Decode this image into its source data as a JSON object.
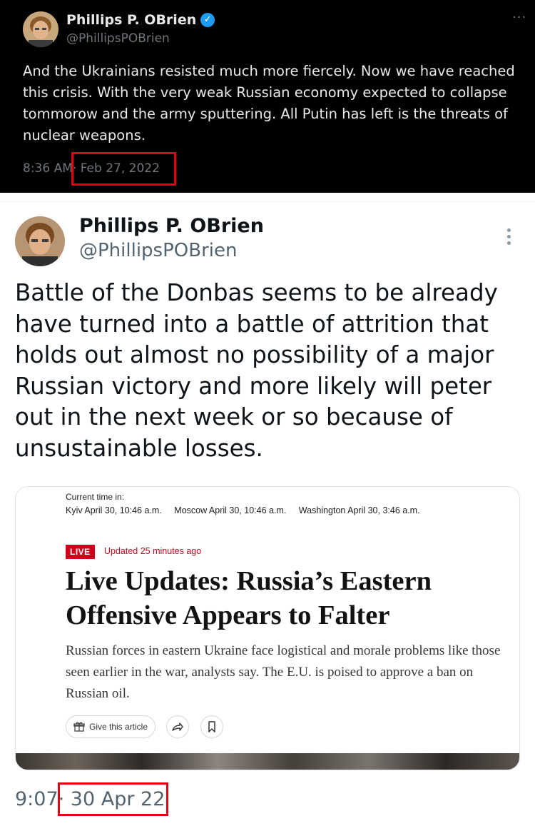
{
  "tweet_top": {
    "author_name": "Phillips P. OBrien",
    "handle": "@PhillipsPOBrien",
    "verified": true,
    "more_icon": "···",
    "text": "And the Ukrainians resisted much more fiercely. Now we have reached this crisis. With the very weak Russian economy expected to collapse tommorow and the army sputtering. All Putin has left is the threats of nuclear weapons.",
    "time": "8:36 AM",
    "date": "· Feb 27, 2022",
    "highlight_color": "#e3000f"
  },
  "tweet_bottom": {
    "author_name": "Phillips P. OBrien",
    "handle": "@PhillipsPOBrien",
    "text": "Battle of the Donbas seems to be already have turned into a battle of attrition that holds out almost no possibility of a major Russian victory and more likely will peter out in the next week or so because of unsustainable losses.",
    "time": "9:07",
    "date": "· 30 Apr 22",
    "highlight_color": "#e3000f"
  },
  "embedded_article": {
    "current_time_label": "Current time in:",
    "cities": [
      "Kyiv April 30, 10:46 a.m.",
      "Moscow April 30, 10:46 a.m.",
      "Washington April 30, 3:46 a.m."
    ],
    "live_badge": "LIVE",
    "updated": "Updated 25 minutes ago",
    "headline": "Live Updates: Russia’s Eastern Offensive Appears to Falter",
    "summary": "Russian forces in eastern Ukraine face logistical and morale problems like those seen earlier in the war, analysts say. The E.U. is poised to approve a ban on Russian oil.",
    "gift_button_label": "Give this article",
    "live_color": "#d0021b"
  }
}
